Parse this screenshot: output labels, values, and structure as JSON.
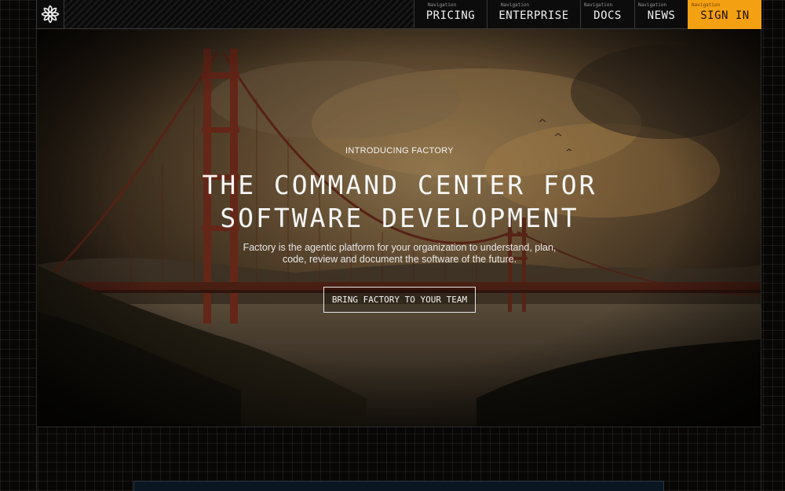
{
  "header": {
    "logo_icon": "factory-asterisk-logo-icon",
    "nav": [
      {
        "tiny": "Navigation",
        "label": "PRICING"
      },
      {
        "tiny": "Navigation",
        "label": "ENTERPRISE"
      },
      {
        "tiny": "Navigation",
        "label": "DOCS"
      },
      {
        "tiny": "Navigation",
        "label": "NEWS"
      },
      {
        "tiny": "Navigation",
        "label": "SIGN IN"
      }
    ],
    "accent": "#f3a012"
  },
  "hero": {
    "eyebrow": "INTRODUCING FACTORY",
    "title_line1": "THE COMMAND CENTER FOR",
    "title_line2": "SOFTWARE DEVELOPMENT",
    "desc_line1": "Factory is the agentic platform for your organization to understand, plan,",
    "desc_line2": "code, review and document the software of the future.",
    "cta": "BRING FACTORY TO YOUR TEAM"
  }
}
